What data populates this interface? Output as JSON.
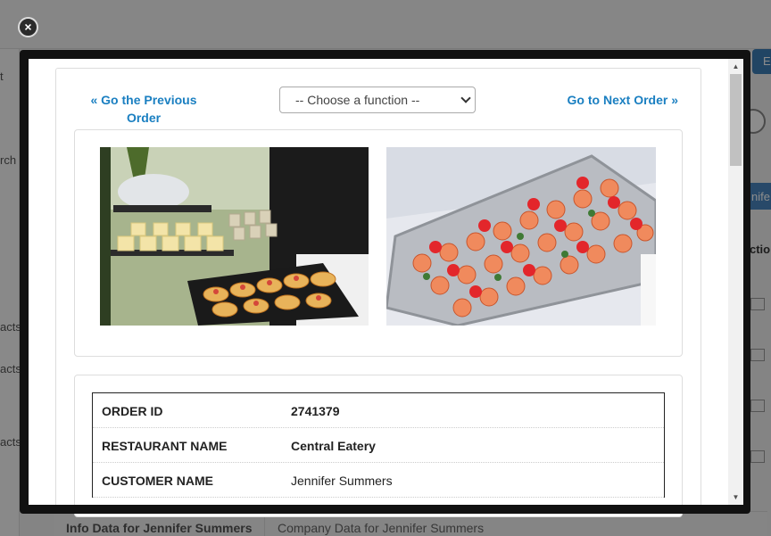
{
  "background": {
    "sidebar_snippets": [
      "t",
      "rch",
      "acts",
      "acts",
      "acts"
    ],
    "right_button": "E",
    "right_tab": "nife",
    "right_label": "ctio",
    "bottom_tabs": [
      "Info Data for Jennifer Summers",
      "Company Data for Jennifer Summers"
    ]
  },
  "modal": {
    "close_glyph": "×",
    "nav": {
      "prev_label": "« Go the Previous Order",
      "next_label": "Go to Next Order »"
    },
    "function_select": {
      "selected": "-- Choose a function --"
    },
    "images": [
      {
        "icon": "catering-table-photo"
      },
      {
        "icon": "canape-platter-photo"
      }
    ],
    "order_info": [
      {
        "label": "ORDER ID",
        "value": "2741379",
        "bold": true
      },
      {
        "label": "RESTAURANT NAME",
        "value": "Central Eatery",
        "bold": true
      },
      {
        "label": "CUSTOMER NAME",
        "value": "Jennifer Summers",
        "bold": false
      }
    ]
  },
  "colors": {
    "link": "#1a7fc1",
    "modal_frame": "#111111",
    "accent_blue": "#3c7fb6"
  }
}
